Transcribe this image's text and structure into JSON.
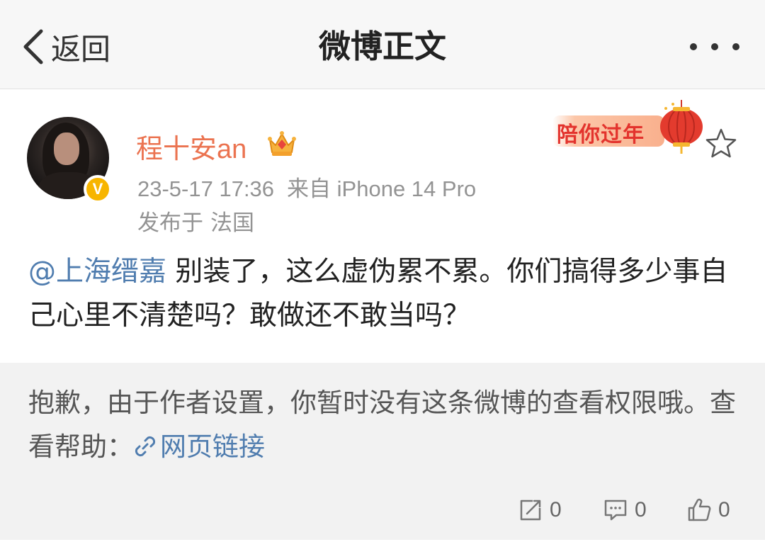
{
  "header": {
    "back_label": "返回",
    "title": "微博正文",
    "more_icon": "more-dots-icon"
  },
  "post": {
    "username": "程十安an",
    "verified_badge": "V",
    "crown_icon": "crown-icon",
    "time": "23-5-17 17:36",
    "source": "来自 iPhone 14 Pro",
    "location_label": "发布于",
    "location": "法国",
    "decoration_text": "陪你过年",
    "mention": "@上海缙嘉",
    "text": " 别装了，这么虚伪累不累。你们搞得多少事自己心里不清楚吗？敢做还不敢当吗？"
  },
  "notice": {
    "text": "抱歉，由于作者设置，你暂时没有这条微博的查看权限哦。查看帮助：",
    "link_label": "网页链接"
  },
  "actions": {
    "repost_count": "0",
    "comment_count": "0",
    "like_count": "0"
  },
  "colors": {
    "username": "#eb7350",
    "link": "#507daf",
    "meta": "#939393",
    "badge": "#f7b500"
  }
}
